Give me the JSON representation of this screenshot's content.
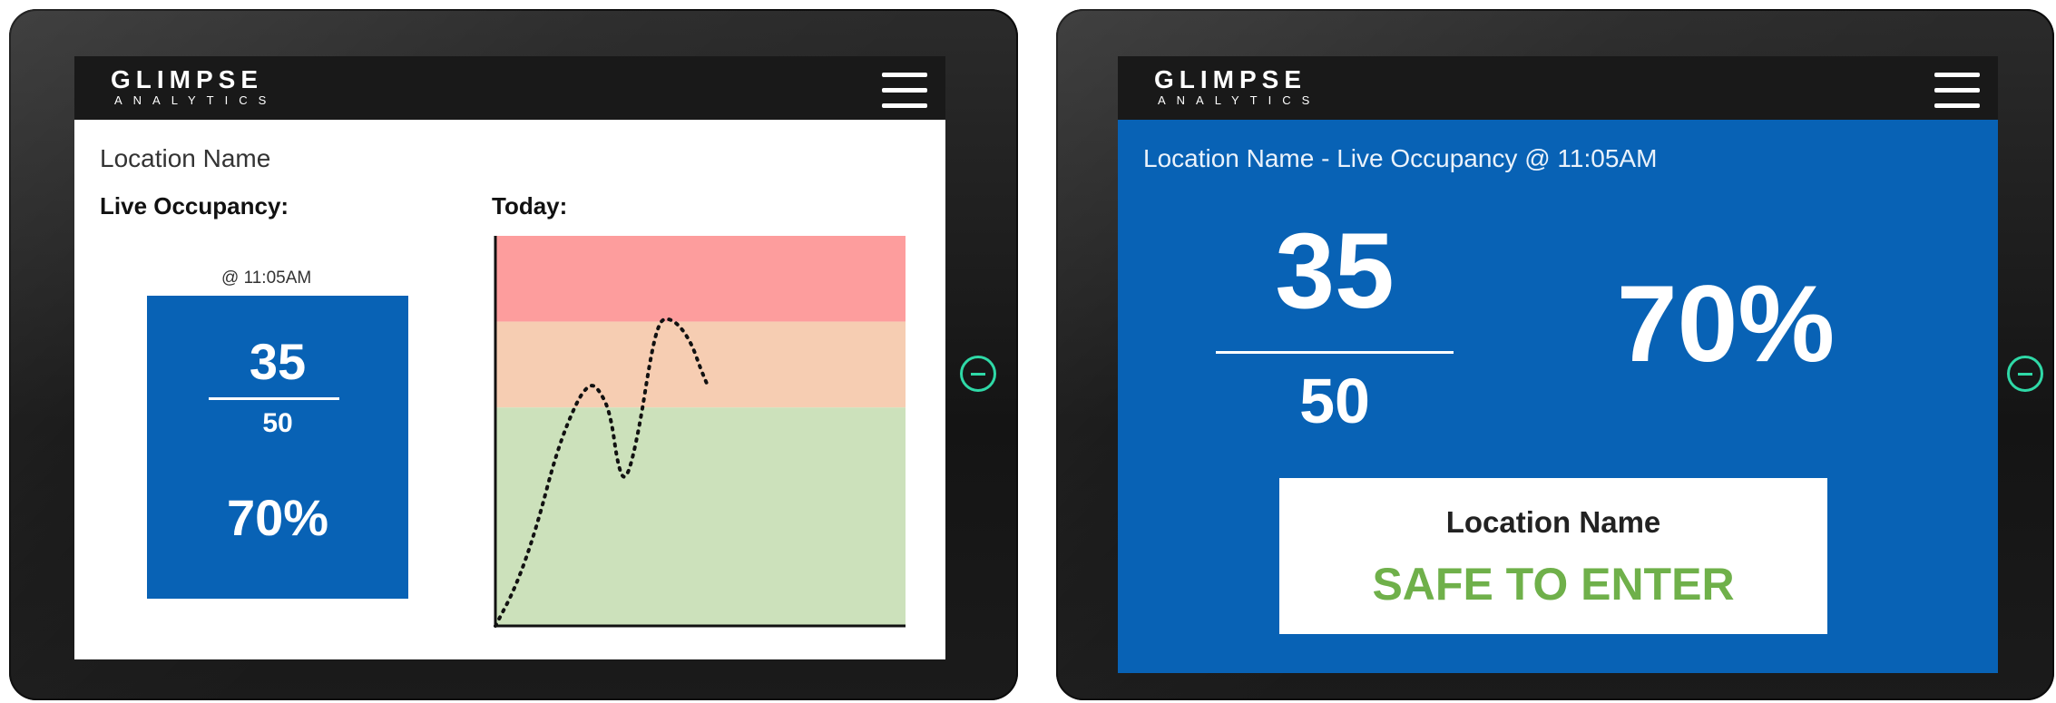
{
  "brand": {
    "name": "GLIMPSE",
    "tagline": "ANALYTICS"
  },
  "colors": {
    "primary_blue": "#0862b5",
    "app_bar": "#191919",
    "zone_red": "#fd9d9d",
    "zone_orange": "#f6cdb2",
    "zone_green": "#cce1bb",
    "safe_green": "#6fb04a",
    "power_indicator": "#2fd9a7"
  },
  "icons": {
    "menu": "hamburger-menu-icon",
    "power": "power-icon"
  },
  "screen1": {
    "location_name": "Location Name",
    "live_label": "Live Occupancy:",
    "today_label": "Today:",
    "time": "@ 11:05AM",
    "current": "35",
    "capacity": "50",
    "percent": "70%"
  },
  "screen2": {
    "header": "Location Name - Live Occupancy @ 11:05AM",
    "current": "35",
    "capacity": "50",
    "percent": "70%",
    "status_location": "Location Name",
    "status_message": "SAFE TO ENTER"
  },
  "chart_data": {
    "type": "line",
    "title": "Today:",
    "xlabel": "",
    "ylabel": "",
    "zones": [
      {
        "name": "red",
        "from": 0.78,
        "to": 1.0
      },
      {
        "name": "orange",
        "from": 0.56,
        "to": 0.78
      },
      {
        "name": "green",
        "from": 0.0,
        "to": 0.56
      }
    ],
    "series": [
      {
        "x": [
          0,
          0.05,
          0.1,
          0.15,
          0.2,
          0.23,
          0.25,
          0.28,
          0.3,
          0.32,
          0.35,
          0.38,
          0.4,
          0.42,
          0.45,
          0.48,
          0.5,
          0.52
        ],
        "y": [
          0,
          0.1,
          0.25,
          0.45,
          0.58,
          0.62,
          0.61,
          0.55,
          0.4,
          0.37,
          0.5,
          0.7,
          0.78,
          0.79,
          0.77,
          0.72,
          0.66,
          0.61
        ]
      }
    ]
  }
}
